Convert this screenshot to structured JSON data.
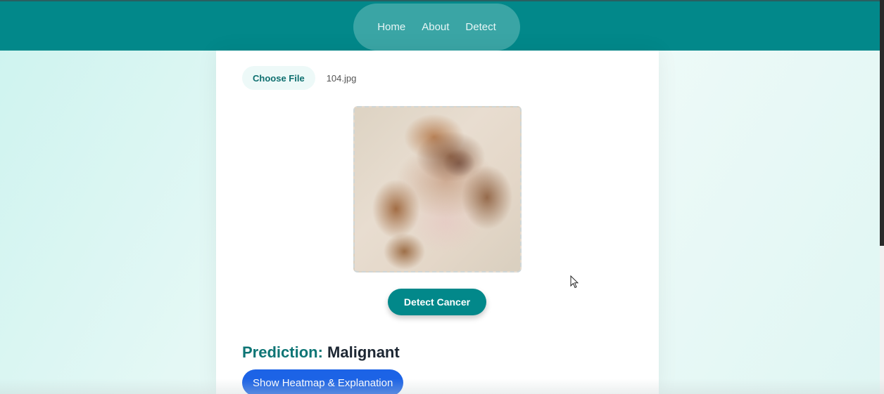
{
  "nav": {
    "items": [
      {
        "label": "Home"
      },
      {
        "label": "About"
      },
      {
        "label": "Detect"
      }
    ]
  },
  "upload": {
    "choose_label": "Choose File",
    "file_name": "104.jpg"
  },
  "preview": {
    "alt": "Uploaded skin lesion image"
  },
  "actions": {
    "detect_label": "Detect Cancer",
    "heatmap_label": "Show Heatmap & Explanation"
  },
  "result": {
    "label": "Prediction:",
    "value": "Malignant"
  },
  "colors": {
    "primary": "#02888a",
    "accent_blue": "#1c63e6",
    "text_dark": "#1d2733"
  }
}
